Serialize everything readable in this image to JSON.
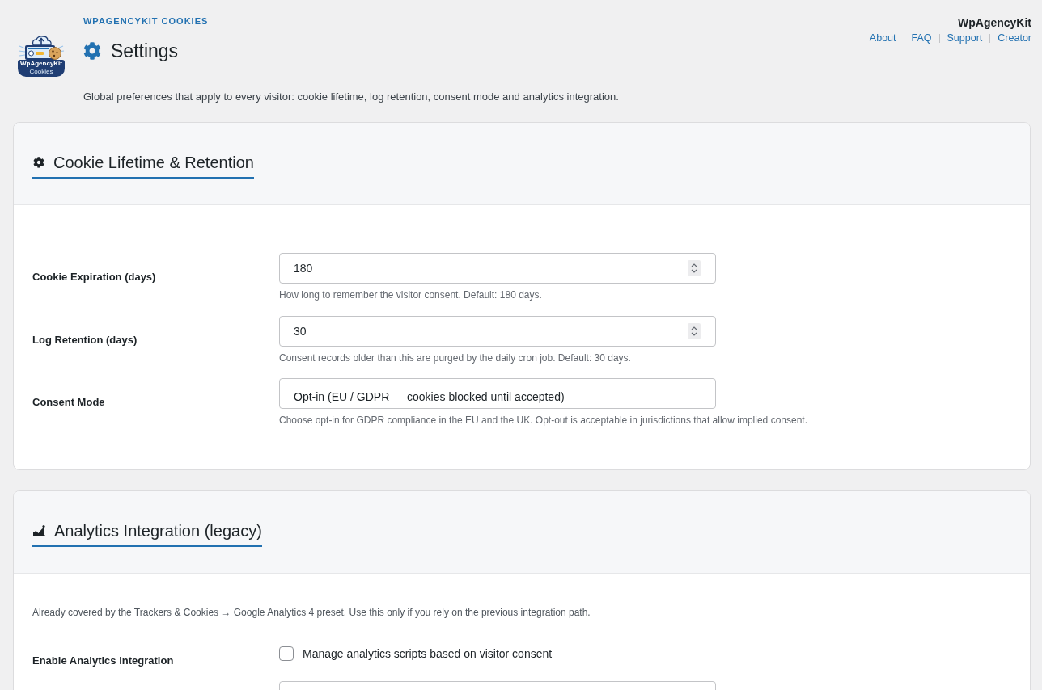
{
  "header": {
    "logo": {
      "wordmark": "WpAgencyKit",
      "subtitle": "Cookies"
    },
    "plugin_name": "WPAGENCYKIT COOKIES",
    "title": "Settings",
    "description": "Global preferences that apply to every visitor: cookie lifetime, log retention, consent mode and analytics integration."
  },
  "brand": {
    "name": "WpAgencyKit",
    "links": [
      "About",
      "FAQ",
      "Support",
      "Creator"
    ]
  },
  "sections": [
    {
      "title": "Cookie Lifetime & Retention",
      "rows": [
        {
          "kind": "number",
          "label": "Cookie Expiration (days)",
          "value": "180",
          "hint": "How long to remember the visitor consent. Default: 180 days."
        },
        {
          "kind": "number",
          "label": "Log Retention (days)",
          "value": "30",
          "hint": "Consent records older than this are purged by the daily cron job. Default: 30 days."
        },
        {
          "kind": "select",
          "label": "Consent Mode",
          "value": "Opt-in (EU / GDPR — cookies blocked until accepted)",
          "hint": "Choose opt-in for GDPR compliance in the EU and the UK. Opt-out is acceptable in jurisdictions that allow implied consent."
        }
      ]
    },
    {
      "title": "Analytics Integration (legacy)",
      "intro": "Already covered by the Trackers & Cookies → Google Analytics 4 preset. Use this only if you rely on the previous integration path.",
      "rows": [
        {
          "kind": "checkbox",
          "label": "Enable Analytics Integration",
          "checked": false,
          "text": "Manage analytics scripts based on visitor consent"
        },
        {
          "kind": "text"
        }
      ]
    }
  ]
}
